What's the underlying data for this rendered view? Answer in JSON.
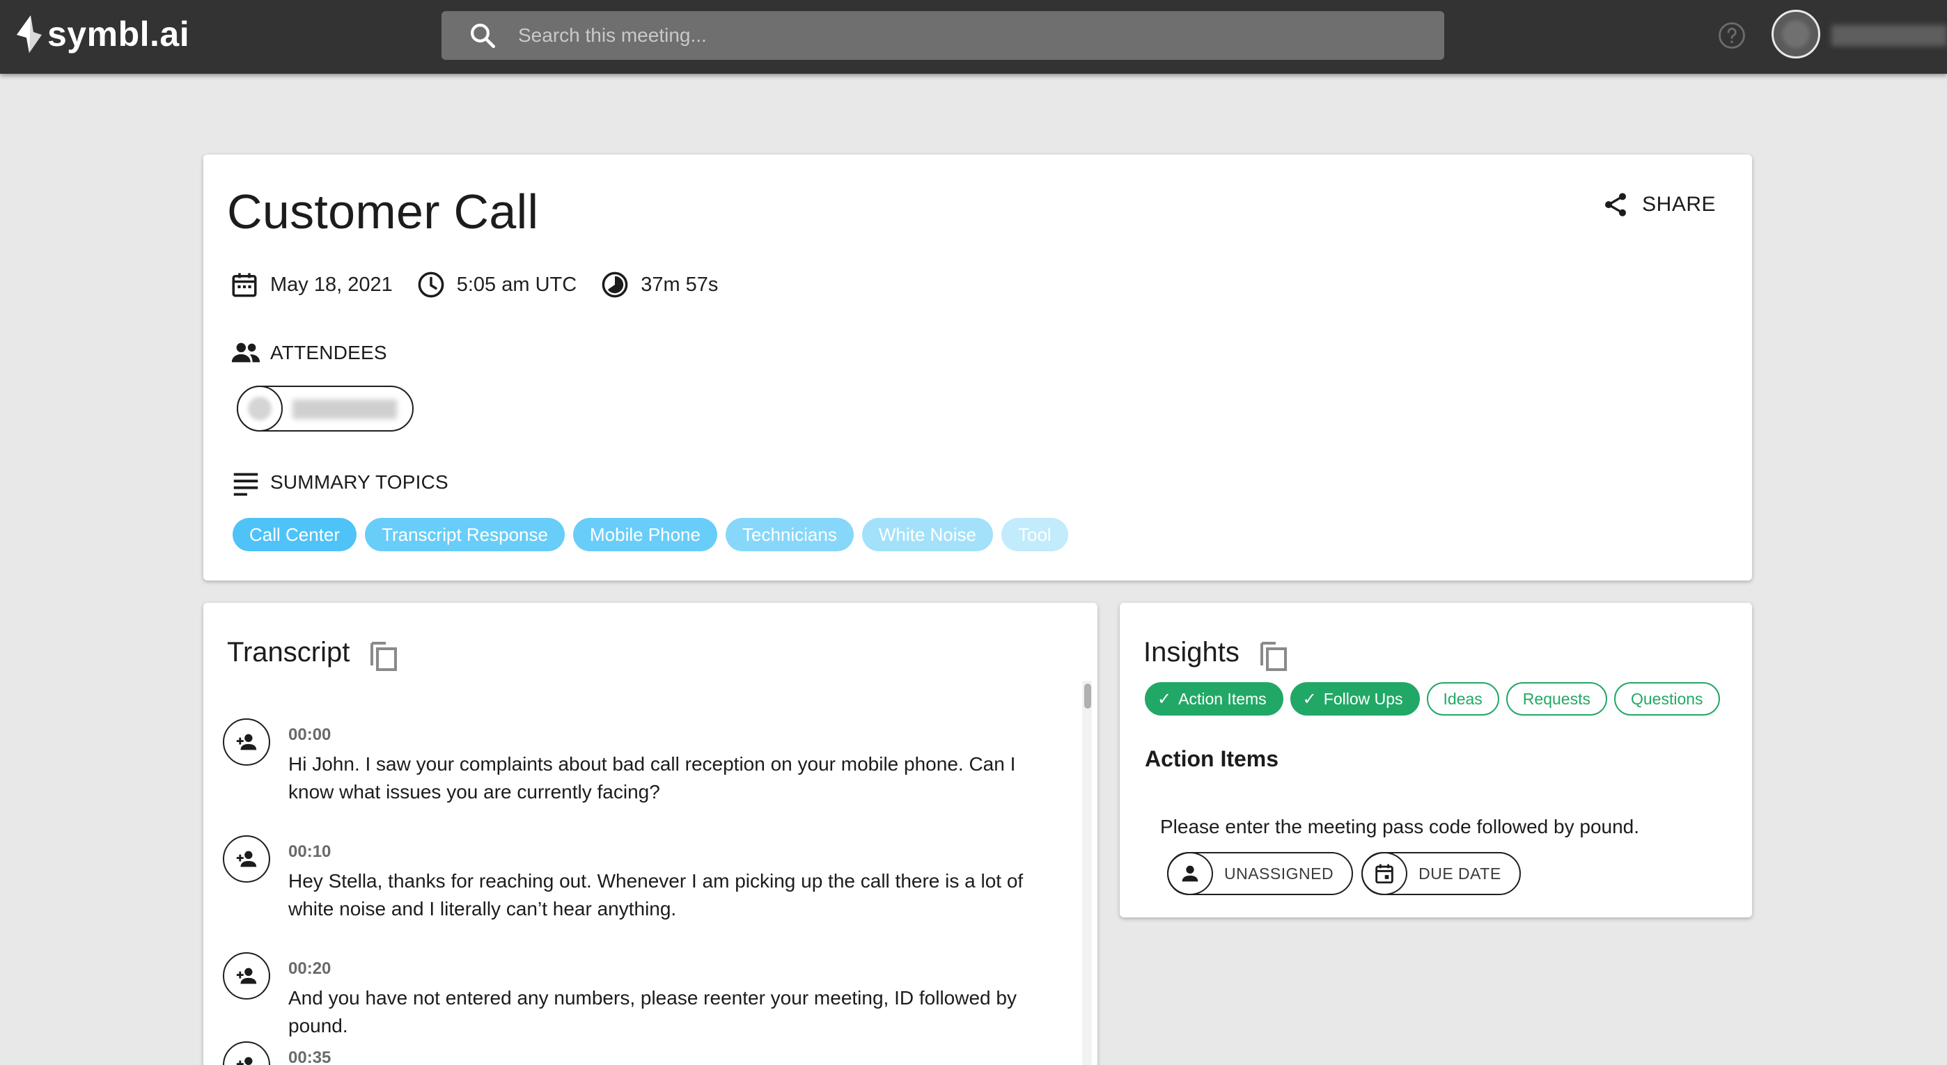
{
  "app": {
    "logo_text": "symbl.ai"
  },
  "search": {
    "placeholder": "Search this meeting..."
  },
  "meeting": {
    "title": "Customer Call",
    "share_label": "SHARE",
    "date": "May 18, 2021",
    "time": "5:05 am UTC",
    "duration": "37m 57s",
    "attendees_label": "ATTENDEES",
    "summary_label": "SUMMARY TOPICS",
    "topics": [
      {
        "label": "Call Center",
        "color": "#4fc3f7"
      },
      {
        "label": "Transcript Response",
        "color": "#68cdf8"
      },
      {
        "label": "Mobile Phone",
        "color": "#68cdf8"
      },
      {
        "label": "Technicians",
        "color": "#86d7fa"
      },
      {
        "label": "White Noise",
        "color": "#a3e1fb"
      },
      {
        "label": "Tool",
        "color": "#c2ebfc"
      }
    ]
  },
  "transcript": {
    "title": "Transcript",
    "items": [
      {
        "time": "00:00",
        "text": "Hi John. I saw your complaints about bad call reception on your mobile phone. Can I know what issues you are currently facing?"
      },
      {
        "time": "00:10",
        "text": "Hey Stella, thanks for reaching out. Whenever I am picking up the call there is a lot of white noise and I literally can’t hear anything."
      },
      {
        "time": "00:20",
        "text": "And you have not entered any numbers, please reenter your meeting, ID followed by pound."
      },
      {
        "time": "00:35",
        "text": ""
      }
    ]
  },
  "insights": {
    "title": "Insights",
    "filters": [
      {
        "label": "Action Items",
        "active": true
      },
      {
        "label": "Follow Ups",
        "active": true
      },
      {
        "label": "Ideas",
        "active": false
      },
      {
        "label": "Requests",
        "active": false
      },
      {
        "label": "Questions",
        "active": false
      }
    ],
    "section_title": "Action Items",
    "item_text": "Please enter the meeting pass code followed by pound.",
    "assignee_label": "UNASSIGNED",
    "due_label": "DUE DATE"
  },
  "colors": {
    "accent_green": "#22a866",
    "topbar": "#333333",
    "topic_blue": "#4fc3f7"
  },
  "icons": [
    "logo-icon",
    "search-icon",
    "help-icon",
    "share-icon",
    "calendar-icon",
    "clock-icon",
    "duration-icon",
    "people-icon",
    "notes-icon",
    "copy-icon",
    "add-person-icon",
    "person-icon",
    "event-icon"
  ]
}
